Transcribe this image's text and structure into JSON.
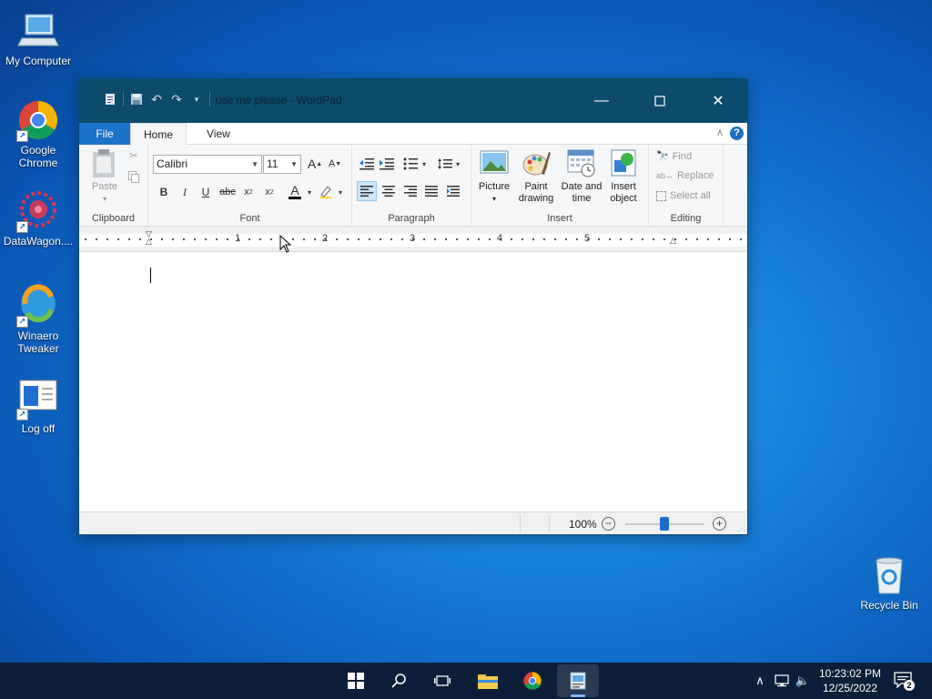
{
  "desktop": {
    "icons": [
      {
        "label": "My Computer"
      },
      {
        "label": "Google Chrome"
      },
      {
        "label": "DataWagon...."
      },
      {
        "label": "Winaero Tweaker"
      },
      {
        "label": "Log off"
      },
      {
        "label": "Recycle Bin"
      }
    ]
  },
  "window": {
    "title": "use me please - WordPad",
    "tabs": {
      "file": "File",
      "home": "Home",
      "view": "View"
    },
    "help": "?",
    "ribbon": {
      "clipboard": {
        "paste": "Paste",
        "label": "Clipboard"
      },
      "font": {
        "family": "Calibri",
        "size": "11",
        "label": "Font"
      },
      "paragraph": {
        "label": "Paragraph"
      },
      "insert": {
        "picture": "Picture",
        "paint": "Paint drawing",
        "datetime": "Date and time",
        "object": "Insert object",
        "label": "Insert"
      },
      "editing": {
        "find": "Find",
        "replace": "Replace",
        "select_all": "Select all",
        "label": "Editing"
      }
    },
    "ruler": {
      "numbers": [
        "1",
        "2",
        "3",
        "4",
        "5"
      ]
    },
    "status": {
      "zoom": "100%",
      "zoom_fraction": 0.5
    }
  },
  "taskbar": {
    "time": "10:23:02 PM",
    "date": "12/25/2022",
    "notifications": "2"
  },
  "colors": {
    "titlebar": "#0c4b6c",
    "file_tab": "#1a73c6",
    "taskbar": "#0d1f38"
  }
}
